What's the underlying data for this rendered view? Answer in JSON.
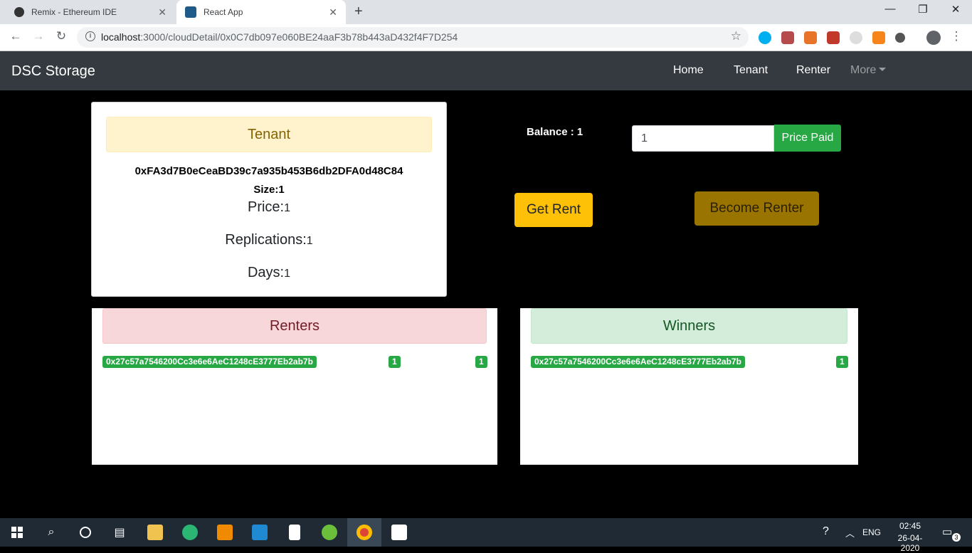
{
  "browser": {
    "tabs": [
      {
        "title": "Remix - Ethereum IDE",
        "active": false
      },
      {
        "title": "React App",
        "active": true
      }
    ],
    "new_tab": "+",
    "window_controls": {
      "minimize": "—",
      "maximize": "❐",
      "close": "✕"
    },
    "url_host": "localhost",
    "url_path": ":3000/cloudDetail/0x0C7db097e060BE24aaF3b78b443aD432f4F7D254"
  },
  "navbar": {
    "brand": "DSC Storage",
    "links": [
      "Home",
      "Tenant",
      "Renter"
    ],
    "more": "More"
  },
  "tenant": {
    "header": "Tenant",
    "address": "0xFA3d7B0eCeaBD39c7a935b453B6db2DFA0d48C84",
    "size_label": "Size:",
    "size_value": "1",
    "price_label": "Price:",
    "price_value": "1",
    "replications_label": "Replications:",
    "replications_value": "1",
    "days_label": "Days:",
    "days_value": "1"
  },
  "actions": {
    "balance": "Balance : 1",
    "price_input_value": "1",
    "price_paid_button": "Price Paid",
    "get_rent_button": "Get Rent",
    "become_renter_button": "Become Renter"
  },
  "renters": {
    "header": "Renters",
    "rows": [
      {
        "address": "0x27c57a7546200Cc3e6e6AeC1248cE3777Eb2ab7b",
        "col2": "1",
        "col3": "1"
      }
    ]
  },
  "winners": {
    "header": "Winners",
    "rows": [
      {
        "address": "0x27c57a7546200Cc3e6e6AeC1248cE3777Eb2ab7b",
        "col2": "1"
      }
    ]
  },
  "taskbar": {
    "language": "ENG",
    "time": "02:45",
    "date": "26-04-2020",
    "notifications": "3"
  },
  "colors": {
    "navbar": "#343a40",
    "success": "#28a745",
    "warning": "#ffc107"
  }
}
